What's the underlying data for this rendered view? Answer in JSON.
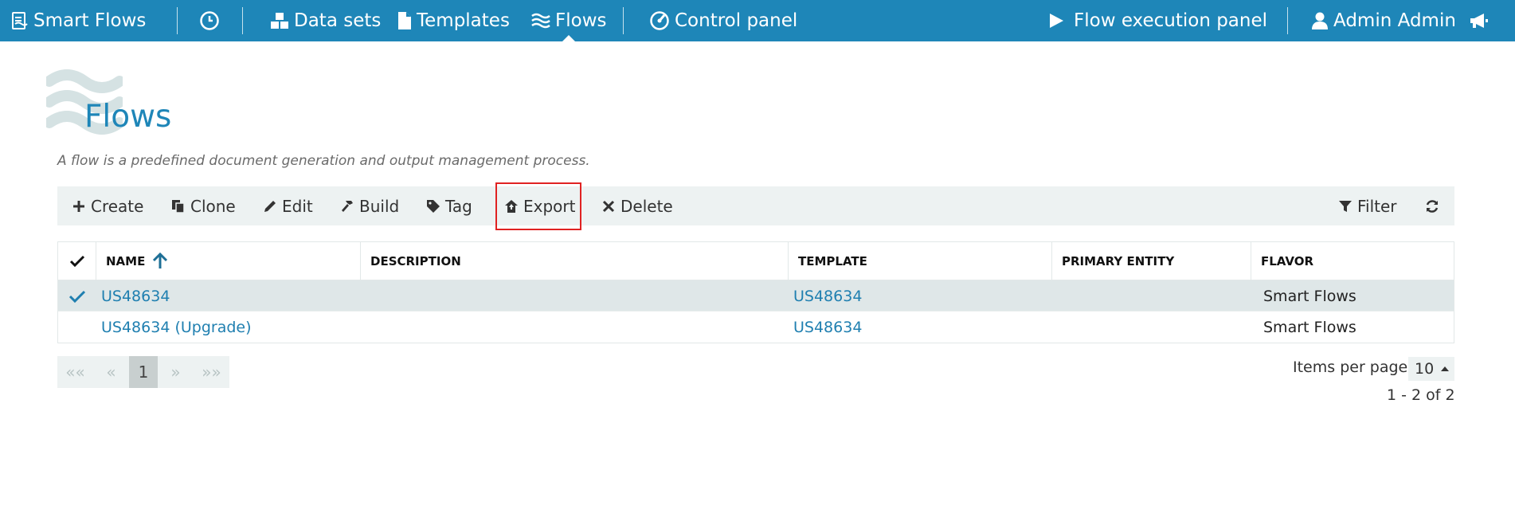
{
  "nav": {
    "brand": "Smart Flows",
    "datasets": "Data sets",
    "templates": "Templates",
    "flows": "Flows",
    "control_panel": "Control panel",
    "execution_panel": "Flow execution panel",
    "user": "Admin Admin"
  },
  "page": {
    "title": "Flows",
    "description": "A flow is a predefined document generation and output management process."
  },
  "toolbar": {
    "create": "Create",
    "clone": "Clone",
    "edit": "Edit",
    "build": "Build",
    "tag": "Tag",
    "export": "Export",
    "delete": "Delete",
    "filter": "Filter"
  },
  "table": {
    "columns": {
      "name": "NAME",
      "description": "DESCRIPTION",
      "template": "TEMPLATE",
      "primary_entity": "PRIMARY ENTITY",
      "flavor": "FLAVOR"
    },
    "rows": [
      {
        "name": "US48634",
        "description": "",
        "template": "US48634",
        "primary_entity": "",
        "flavor": "Smart Flows",
        "selected": true
      },
      {
        "name": "US48634 (Upgrade)",
        "description": "",
        "template": "US48634",
        "primary_entity": "",
        "flavor": "Smart Flows",
        "selected": false
      }
    ]
  },
  "pagination": {
    "first": "««",
    "prev": "«",
    "current": "1",
    "next": "»",
    "last": "»»",
    "items_per_page_label": "Items per page",
    "items_per_page": "10",
    "range": "1 - 2 of 2"
  },
  "colors": {
    "topbar": "#1e86b8",
    "link": "#1f7fb0",
    "toolbar_bg": "#edf2f2",
    "highlight": "#e02222"
  }
}
